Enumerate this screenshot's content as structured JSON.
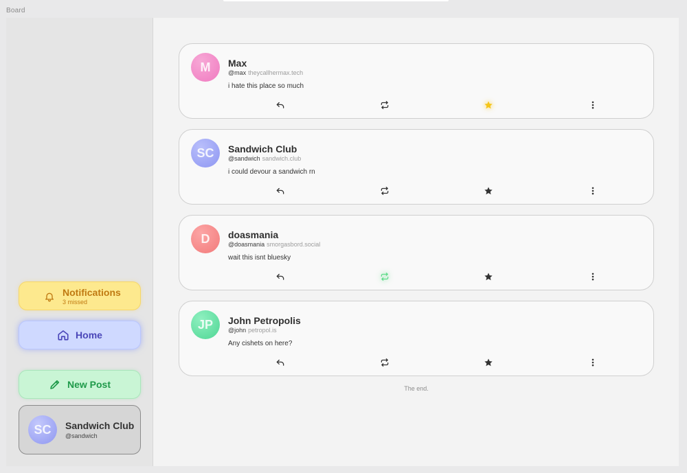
{
  "window": {
    "title": "Board"
  },
  "sidebar": {
    "notifications": {
      "label": "Notifications",
      "sub": "3 missed",
      "icon": "bell-icon"
    },
    "home": {
      "label": "Home",
      "icon": "home-icon"
    },
    "new_post": {
      "label": "New Post",
      "icon": "pencil-icon"
    },
    "profile": {
      "initials": "SC",
      "name": "Sandwich Club",
      "handle": "@sandwich"
    }
  },
  "posts": [
    {
      "initials": "M",
      "name": "Max",
      "handle": "@max",
      "domain": "theycallhermax.tech",
      "content": "i hate this place so much",
      "avatar_gradient": [
        "#f7a8d6",
        "#f07ac0"
      ],
      "favorited": true,
      "boosted": false
    },
    {
      "initials": "SC",
      "name": "Sandwich Club",
      "handle": "@sandwich",
      "domain": "sandwich.club",
      "content": "i could devour a sandwich rn",
      "avatar_gradient": [
        "#b9bffb",
        "#8e96f2"
      ],
      "favorited": false,
      "boosted": false
    },
    {
      "initials": "D",
      "name": "doasmania",
      "handle": "@doasmania",
      "domain": "smorgasbord.social",
      "content": "wait this isnt bluesky",
      "avatar_gradient": [
        "#fca5a5",
        "#f27a7a"
      ],
      "favorited": false,
      "boosted": true
    },
    {
      "initials": "JP",
      "name": "John Petropolis",
      "handle": "@john",
      "domain": "petropol.is",
      "content": "Any cishets on here?",
      "avatar_gradient": [
        "#8ff0c0",
        "#4fd694"
      ],
      "favorited": false,
      "boosted": false
    }
  ],
  "feed_end": "The end.",
  "colors": {
    "accent_gold": "#f5c518",
    "accent_green": "#5fdc8a",
    "icon_default": "#333333"
  }
}
